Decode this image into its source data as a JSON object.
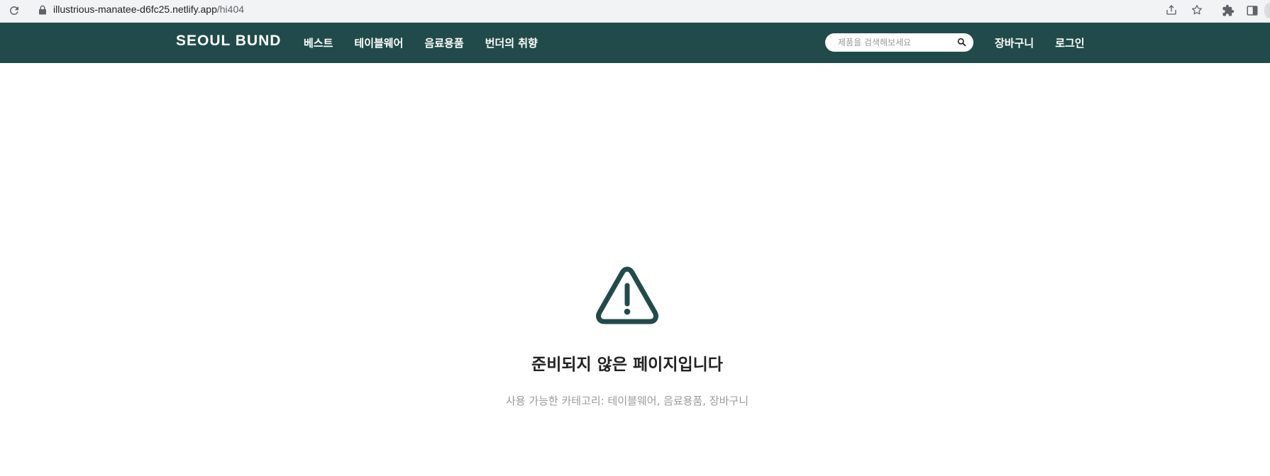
{
  "browser": {
    "url_host": "illustrious-manatee-d6fc25.netlify.app",
    "url_path": "/hi404",
    "icons": {
      "reload": "reload-icon",
      "lock": "lock-icon",
      "share": "share-icon",
      "star": "star-icon",
      "extensions": "puzzle-icon",
      "side_panel": "side-panel-icon"
    }
  },
  "header": {
    "logo": "SEOUL BUND",
    "nav": [
      "베스트",
      "테이블웨어",
      "음료용품",
      "번더의 취향"
    ],
    "search": {
      "placeholder": "제품을 검색해보세요",
      "value": ""
    },
    "cart_label": "장바구니",
    "login_label": "로그인",
    "background_color": "#214b4a"
  },
  "main": {
    "title": "준비되지 않은 페이지입니다",
    "subtitle": "사용 가능한 카테고리: 테이블웨어, 음료용품, 장바구니",
    "icon": "warning-icon",
    "icon_color": "#214b4a"
  }
}
